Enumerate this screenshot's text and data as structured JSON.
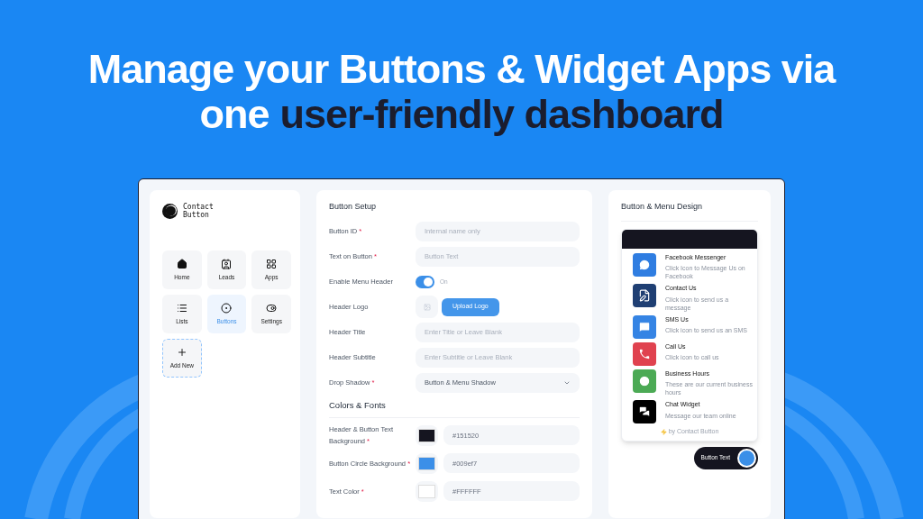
{
  "headline": {
    "line1": "Manage your Buttons & Widget Apps via",
    "plain": "one",
    "highlight": "user-friendly dashboard"
  },
  "sidebar": {
    "logo_text": [
      "Contact",
      "Button"
    ],
    "items": [
      {
        "label": "Home",
        "selected": false
      },
      {
        "label": "Leads",
        "selected": false
      },
      {
        "label": "Apps",
        "selected": false
      },
      {
        "label": "Lists",
        "selected": false
      },
      {
        "label": "Buttons",
        "selected": true
      },
      {
        "label": "Settings",
        "selected": false
      }
    ],
    "add_new": "Add New"
  },
  "setup": {
    "title": "Button Setup",
    "required_mark": "*",
    "fields": [
      {
        "kind": "input",
        "label": "Button ID",
        "required": true,
        "placeholder": "Internal name only"
      },
      {
        "kind": "input",
        "label": "Text on Button",
        "required": true,
        "placeholder": "Button Text"
      },
      {
        "kind": "toggle",
        "label": "Enable Menu Header",
        "required": false,
        "on": true,
        "state_text": "On"
      },
      {
        "kind": "upload",
        "label": "Header Logo",
        "required": false,
        "button": "Upload Logo"
      },
      {
        "kind": "input",
        "label": "Header Title",
        "required": false,
        "placeholder": "Enter Title or Leave Blank"
      },
      {
        "kind": "input",
        "label": "Header Subtitle",
        "required": false,
        "placeholder": "Enter Subtitle or Leave Blank"
      },
      {
        "kind": "select",
        "label": "Drop Shadow",
        "required": true,
        "value": "Button & Menu Shadow"
      }
    ],
    "colors_title": "Colors & Fonts",
    "colors": [
      {
        "label": "Header & Button Text Background",
        "required": true,
        "value": "#151520",
        "color": "#151520"
      },
      {
        "label": "Button Circle Background",
        "required": true,
        "value": "#009ef7",
        "color": "#3b8fe8"
      },
      {
        "label": "Text Color",
        "required": true,
        "value": "#FFFFFF",
        "color": "#ffffff"
      }
    ]
  },
  "design": {
    "title": "Button & Menu Design",
    "menu_items": [
      {
        "title": "Facebook Messenger",
        "subtitle": "Click Icon to Message Us on Facebook",
        "color": "#2f7de1"
      },
      {
        "title": "Contact Us",
        "subtitle": "Click icon to send us a message",
        "color": "#1f3f73"
      },
      {
        "title": "SMS Us",
        "subtitle": "Click icon to send us an SMS",
        "color": "#3584e4"
      },
      {
        "title": "Call Us",
        "subtitle": "Click icon to call us",
        "color": "#e0424f"
      },
      {
        "title": "Business Hours",
        "subtitle": "These are our current business hours",
        "color": "#4caa55"
      },
      {
        "title": "Chat Widget",
        "subtitle": "Message our team online",
        "color": "#000000"
      }
    ],
    "footer": "by Contact Button",
    "button_text": "Button Text"
  }
}
